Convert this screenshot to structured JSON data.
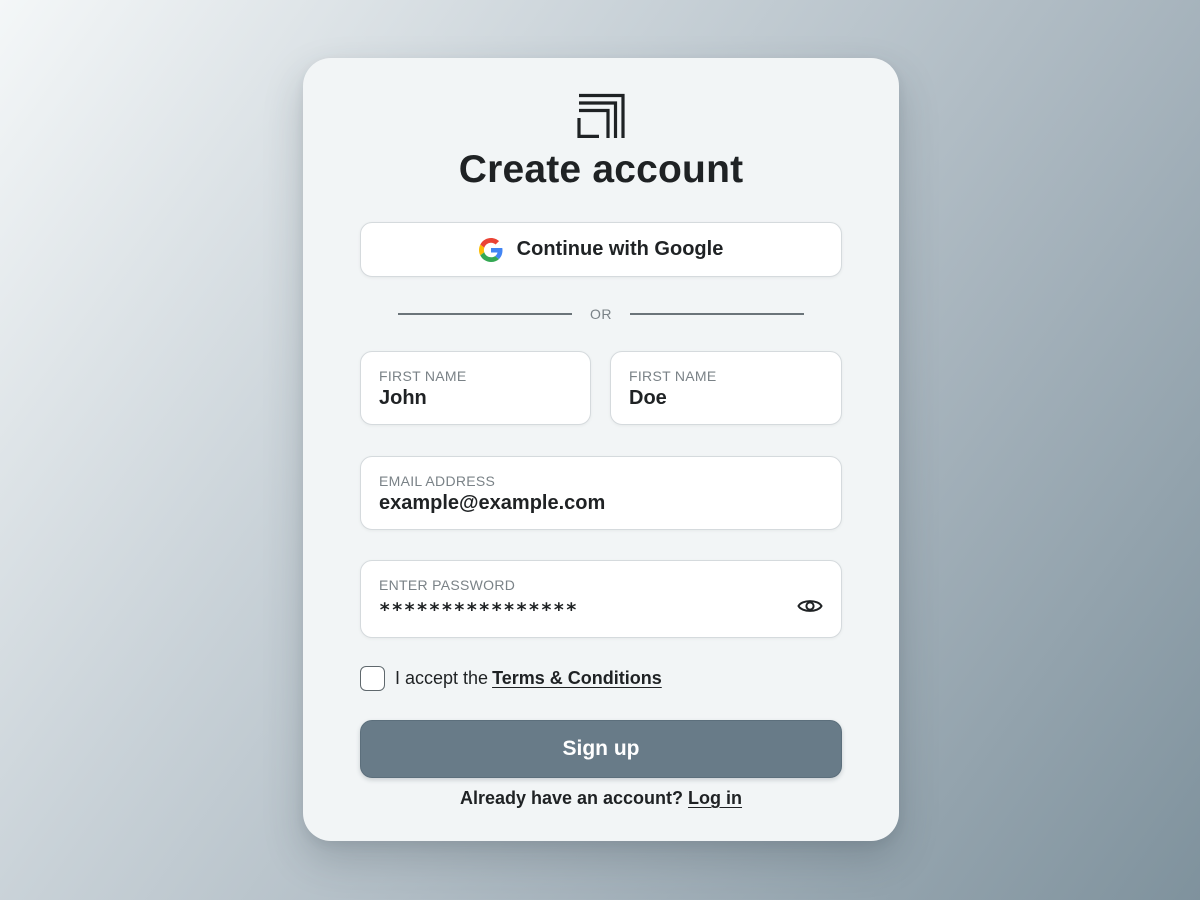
{
  "card": {
    "title": "Create account",
    "logo_icon": "stacked-corners-logo"
  },
  "google": {
    "label": "Continue with Google",
    "icon": "google-g-icon"
  },
  "divider": {
    "text": "OR"
  },
  "fields": {
    "first_name": {
      "label": "FIRST NAME",
      "value": "John"
    },
    "last_name": {
      "label": "FIRST NAME",
      "value": "Doe"
    },
    "email": {
      "label": "EMAIL ADDRESS",
      "value": "example@example.com"
    },
    "password": {
      "label": "ENTER PASSWORD",
      "value": "****************",
      "toggle_icon": "eye-icon"
    }
  },
  "terms": {
    "checked": false,
    "text": "I accept the",
    "link": "Terms & Conditions"
  },
  "signup": {
    "label": "Sign up"
  },
  "login": {
    "text": "Already have an account?",
    "link": "Log in"
  },
  "colors": {
    "primary_button": "#687b88",
    "text": "#1f2224",
    "card_bg": "#f2f5f6"
  }
}
